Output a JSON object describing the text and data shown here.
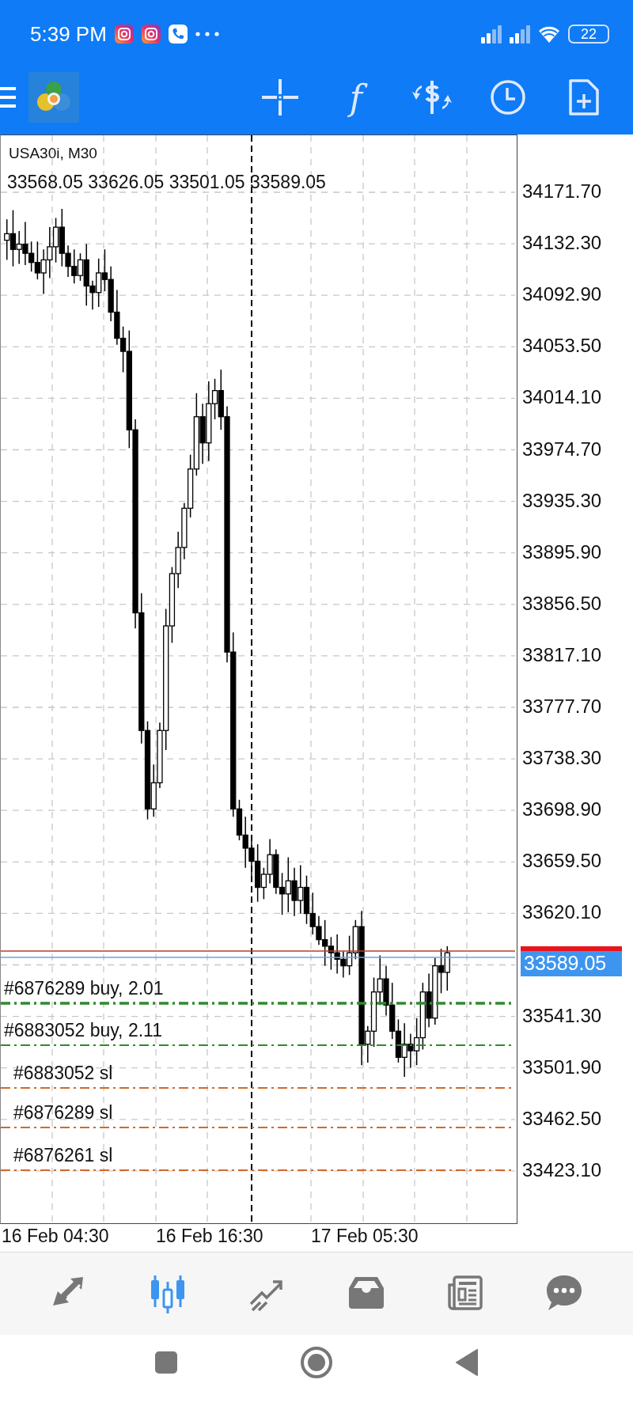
{
  "status_bar": {
    "time": "5:39 PM",
    "battery": "22"
  },
  "toolbar": {
    "function_label": "f"
  },
  "chart": {
    "symbol": "USA30i, M30",
    "ohlc": "33568.05 33626.05 33501.05 33589.05",
    "price_labels": [
      "34171.70",
      "34132.30",
      "34092.90",
      "34053.50",
      "34014.10",
      "33974.70",
      "33935.30",
      "33895.90",
      "33856.50",
      "33817.10",
      "33777.70",
      "33738.30",
      "33698.90",
      "33659.50",
      "33620.10",
      "33541.30",
      "33501.90",
      "33462.50",
      "33423.10"
    ],
    "current_price": "33589.05",
    "trade_lines": [
      {
        "label": "#6876289 buy, 2.01",
        "kind": "buy"
      },
      {
        "label": "#6883052 buy, 2.11",
        "kind": "buy"
      },
      {
        "label": "#6883052 sl",
        "kind": "sl"
      },
      {
        "label": "#6876289 sl",
        "kind": "sl"
      },
      {
        "label": "#6876261 sl",
        "kind": "sl"
      }
    ],
    "time_labels": [
      "16 Feb 04:30",
      "16 Feb 16:30",
      "17 Feb 05:30"
    ]
  },
  "bottom_nav": [
    {
      "selected": false
    },
    {
      "selected": true
    },
    {
      "selected": false
    },
    {
      "selected": false
    },
    {
      "selected": false
    },
    {
      "selected": false
    }
  ]
}
